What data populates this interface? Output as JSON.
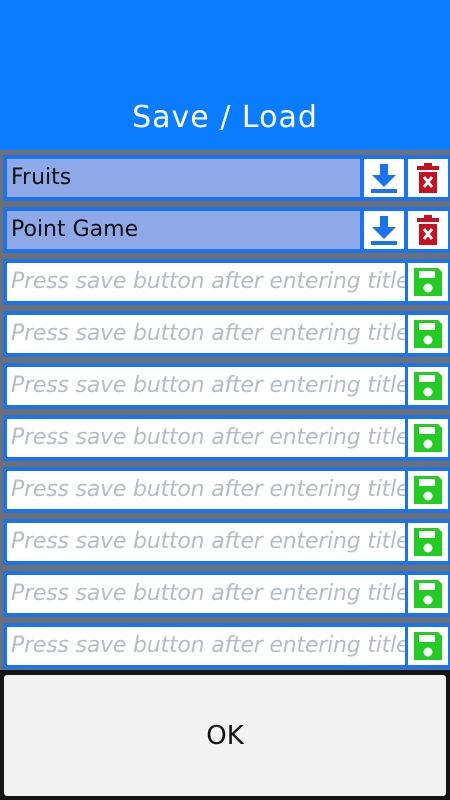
{
  "header": {
    "title": "Save / Load"
  },
  "slots": [
    {
      "title": "Fruits",
      "saved": true
    },
    {
      "title": "Point Game",
      "saved": true
    },
    {
      "placeholder": "Press save button after entering title",
      "saved": false
    },
    {
      "placeholder": "Press save button after entering title",
      "saved": false
    },
    {
      "placeholder": "Press save button after entering title",
      "saved": false
    },
    {
      "placeholder": "Press save button after entering title",
      "saved": false
    },
    {
      "placeholder": "Press save button after entering title",
      "saved": false
    },
    {
      "placeholder": "Press save button after entering title",
      "saved": false
    },
    {
      "placeholder": "Press save button after entering title",
      "saved": false
    },
    {
      "placeholder": "Press save button after entering title",
      "saved": false
    }
  ],
  "icons": {
    "load": "download-icon",
    "delete": "trash-icon",
    "save": "floppy-disk-icon"
  },
  "colors": {
    "header": "#0a7cff",
    "saved_slot": "#8fa9e8",
    "load_icon": "#1a73f0",
    "delete_icon": "#c8101e",
    "save_icon": "#22cc22"
  },
  "footer": {
    "ok_label": "OK"
  }
}
